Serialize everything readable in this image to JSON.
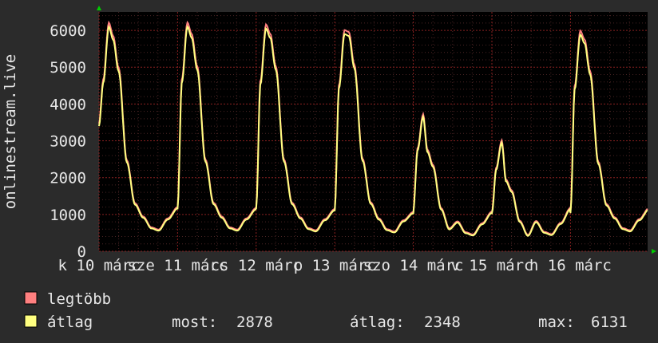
{
  "chart_data": {
    "type": "line",
    "ylabel": "onlinestream.live",
    "ylim": [
      0,
      6500
    ],
    "yticks": [
      0,
      1000,
      2000,
      3000,
      4000,
      5000,
      6000
    ],
    "xticks": [
      {
        "label": "k 10 márc",
        "day": 0
      },
      {
        "label": "sze 11 márc",
        "day": 1
      },
      {
        "label": "cs 12 márc",
        "day": 2
      },
      {
        "label": "p 13 márc",
        "day": 3
      },
      {
        "label": "szo 14 márc",
        "day": 4
      },
      {
        "label": "v 15 márc",
        "day": 5
      },
      {
        "label": "h 16 márc",
        "day": 6
      }
    ],
    "grid": true,
    "colors": {
      "legtobb": "#ff8080",
      "atlag": "#ffff80",
      "plot_bg": "#000000",
      "grid": "#7a1c1c"
    },
    "series": [
      {
        "name": "legtöbb"
      },
      {
        "name": "átlag"
      }
    ],
    "daily": [
      {
        "peak": 6100,
        "plateau": 5750,
        "trough": 560
      },
      {
        "peak": 6100,
        "plateau": 5800,
        "trough": 560
      },
      {
        "peak": 6050,
        "plateau": 5800,
        "trough": 540
      },
      {
        "peak": 5900,
        "plateau": 5850,
        "trough": 510
      },
      {
        "peak": 3650,
        "plateau": 2700,
        "trough": 430
      },
      {
        "peak": 2950,
        "plateau": 1900,
        "trough": 440
      },
      {
        "peak": 5880,
        "plateau": 5650,
        "trough": 540
      }
    ],
    "stats": {
      "most_label": "most:",
      "most": "2878",
      "atlag_label": "átlag:",
      "atlag": "2348",
      "max_label": "max:",
      "max": "6131"
    }
  }
}
